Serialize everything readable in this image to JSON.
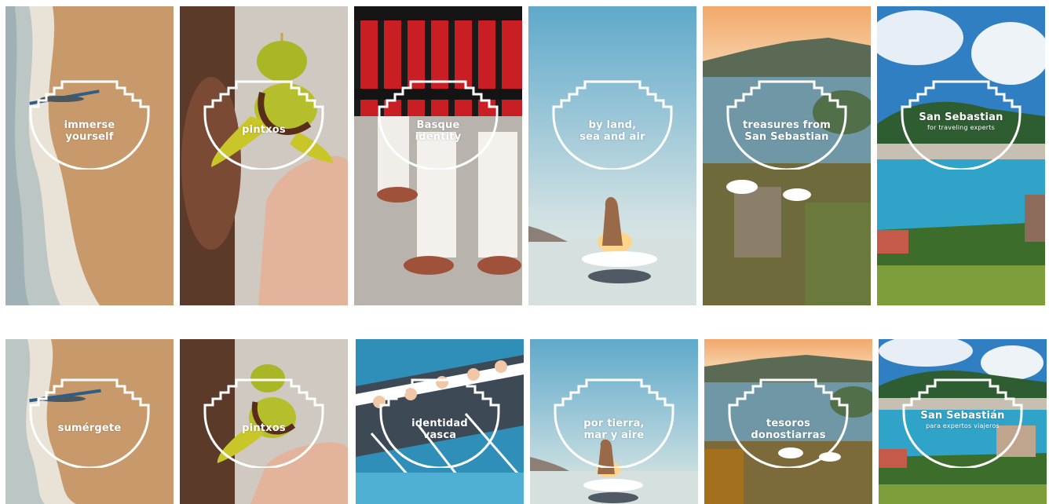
{
  "rows": [
    {
      "tiles": [
        {
          "line1": "immerse",
          "line2": "yourself"
        },
        {
          "line1": "pintxos",
          "line2": ""
        },
        {
          "line1": "Basque",
          "line2": "identity"
        },
        {
          "line1": "by land,",
          "line2": "sea and air"
        },
        {
          "line1": "treasures from",
          "line2": "San Sebastian"
        },
        {
          "line1": "San Sebastian",
          "sub": "for traveling experts"
        }
      ]
    },
    {
      "tiles": [
        {
          "line1": "sumérgete",
          "line2": ""
        },
        {
          "line1": "pintxos",
          "line2": ""
        },
        {
          "line1": "identidad",
          "line2": "vasca"
        },
        {
          "line1": "por tierra,",
          "line2": "mar y aire"
        },
        {
          "line1": "tesoros",
          "line2": "donostiarras"
        },
        {
          "line1": "San Sebastián",
          "sub": "para expertos viajeros"
        }
      ]
    }
  ],
  "colors": {
    "sand": "#c79b6d",
    "sea_blue": "#2f8fb8",
    "sky": "#8ec3dc",
    "red_skirt": "#c81e24",
    "olive": "#a9b626",
    "grass": "#5a8a2c",
    "sunset": "#f0b27a"
  }
}
